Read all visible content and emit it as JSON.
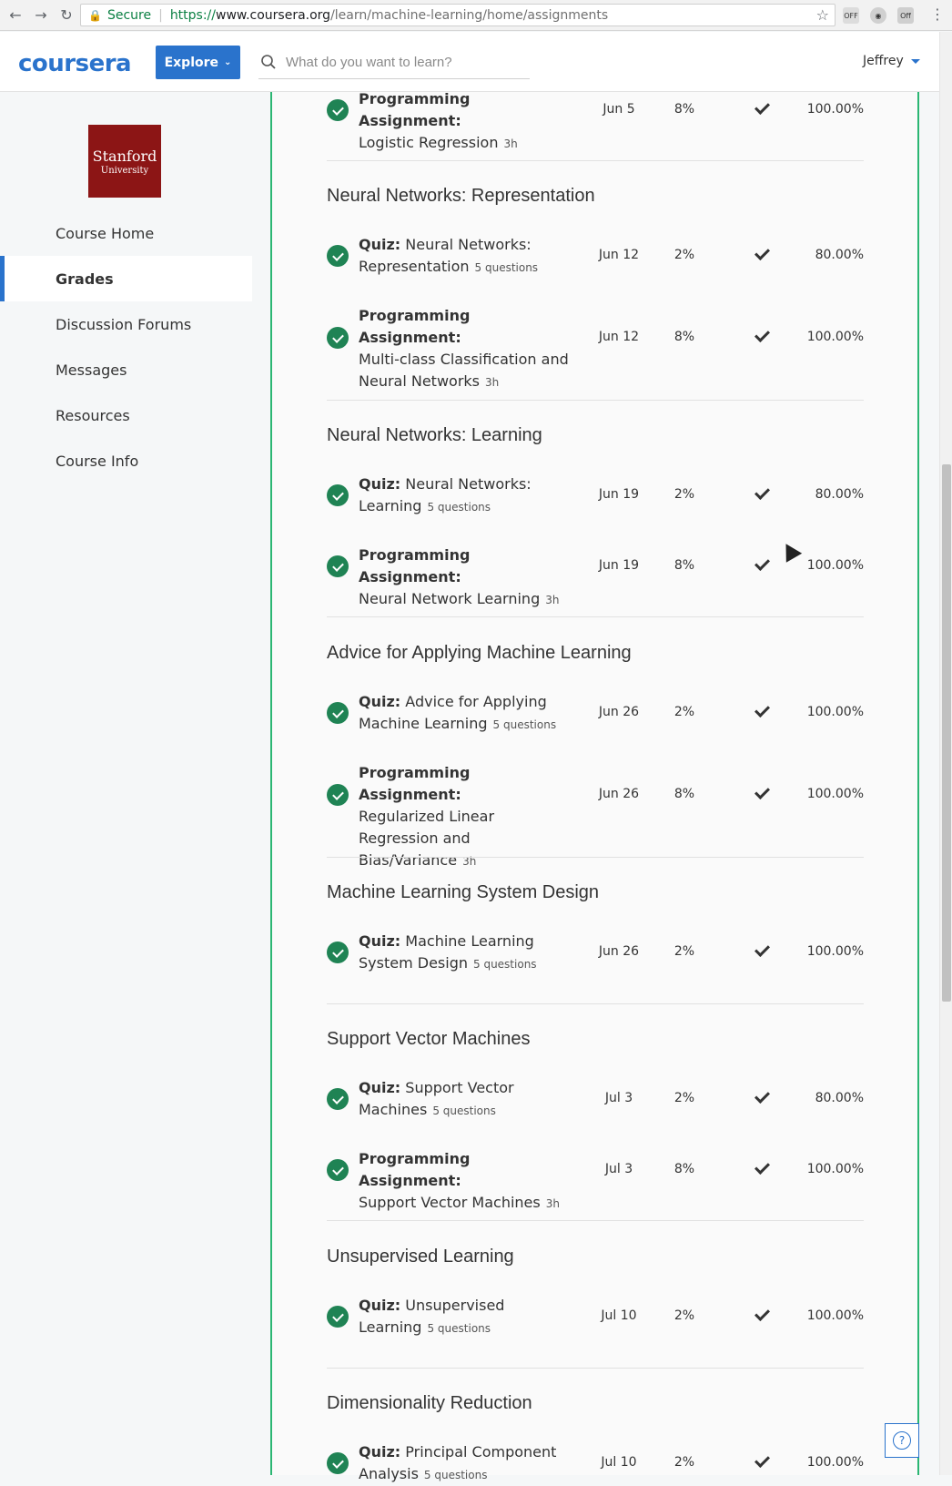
{
  "browser": {
    "secure_label": "Secure",
    "url_scheme": "https://",
    "url_host": "www.coursera.org",
    "url_path": "/learn/machine-learning/home/assignments"
  },
  "header": {
    "logo": "coursera",
    "explore_label": "Explore",
    "search_placeholder": "What do you want to learn?",
    "user_name": "Jeffrey"
  },
  "sidebar": {
    "university_line1": "Stanford",
    "university_line2": "University",
    "items": [
      {
        "label": "Course Home"
      },
      {
        "label": "Grades"
      },
      {
        "label": "Discussion Forums"
      },
      {
        "label": "Messages"
      },
      {
        "label": "Resources"
      },
      {
        "label": "Course Info"
      }
    ]
  },
  "sections": [
    {
      "title": "",
      "items": [
        {
          "type": "Programming Assignment:",
          "name": "Logistic Regression",
          "meta": "3h",
          "due": "Jun 5",
          "weight": "8%",
          "score": "100.00%"
        }
      ]
    },
    {
      "title": "Neural Networks: Representation",
      "items": [
        {
          "type": "Quiz:",
          "name": "Neural Networks: Representation",
          "meta": "5 questions",
          "due": "Jun 12",
          "weight": "2%",
          "score": "80.00%"
        },
        {
          "type": "Programming Assignment:",
          "name": "Multi-class Classification and Neural Networks",
          "meta": "3h",
          "due": "Jun 12",
          "weight": "8%",
          "score": "100.00%"
        }
      ]
    },
    {
      "title": "Neural Networks: Learning",
      "items": [
        {
          "type": "Quiz:",
          "name": "Neural Networks: Learning",
          "meta": "5 questions",
          "due": "Jun 19",
          "weight": "2%",
          "score": "80.00%"
        },
        {
          "type": "Programming Assignment:",
          "name": "Neural Network Learning",
          "meta": "3h",
          "due": "Jun 19",
          "weight": "8%",
          "score": "100.00%"
        }
      ]
    },
    {
      "title": "Advice for Applying Machine Learning",
      "items": [
        {
          "type": "Quiz:",
          "name": "Advice for Applying Machine Learning",
          "meta": "5 questions",
          "due": "Jun 26",
          "weight": "2%",
          "score": "100.00%"
        },
        {
          "type": "Programming Assignment:",
          "name": "Regularized Linear Regression and Bias/Variance",
          "meta": "3h",
          "due": "Jun 26",
          "weight": "8%",
          "score": "100.00%"
        }
      ]
    },
    {
      "title": "Machine Learning System Design",
      "items": [
        {
          "type": "Quiz:",
          "name": "Machine Learning System Design",
          "meta": "5 questions",
          "due": "Jun 26",
          "weight": "2%",
          "score": "100.00%"
        }
      ]
    },
    {
      "title": "Support Vector Machines",
      "items": [
        {
          "type": "Quiz:",
          "name": "Support Vector Machines",
          "meta": "5 questions",
          "due": "Jul 3",
          "weight": "2%",
          "score": "80.00%"
        },
        {
          "type": "Programming Assignment:",
          "name": "Support Vector Machines",
          "meta": "3h",
          "due": "Jul 3",
          "weight": "8%",
          "score": "100.00%"
        }
      ]
    },
    {
      "title": "Unsupervised Learning",
      "items": [
        {
          "type": "Quiz:",
          "name": "Unsupervised Learning",
          "meta": "5 questions",
          "due": "Jul 10",
          "weight": "2%",
          "score": "100.00%"
        }
      ]
    },
    {
      "title": "Dimensionality Reduction",
      "items": [
        {
          "type": "Quiz:",
          "name": "Principal Component Analysis",
          "meta": "5 questions",
          "due": "Jul 10",
          "weight": "2%",
          "score": "100.00%"
        }
      ]
    }
  ],
  "help_label": "?"
}
